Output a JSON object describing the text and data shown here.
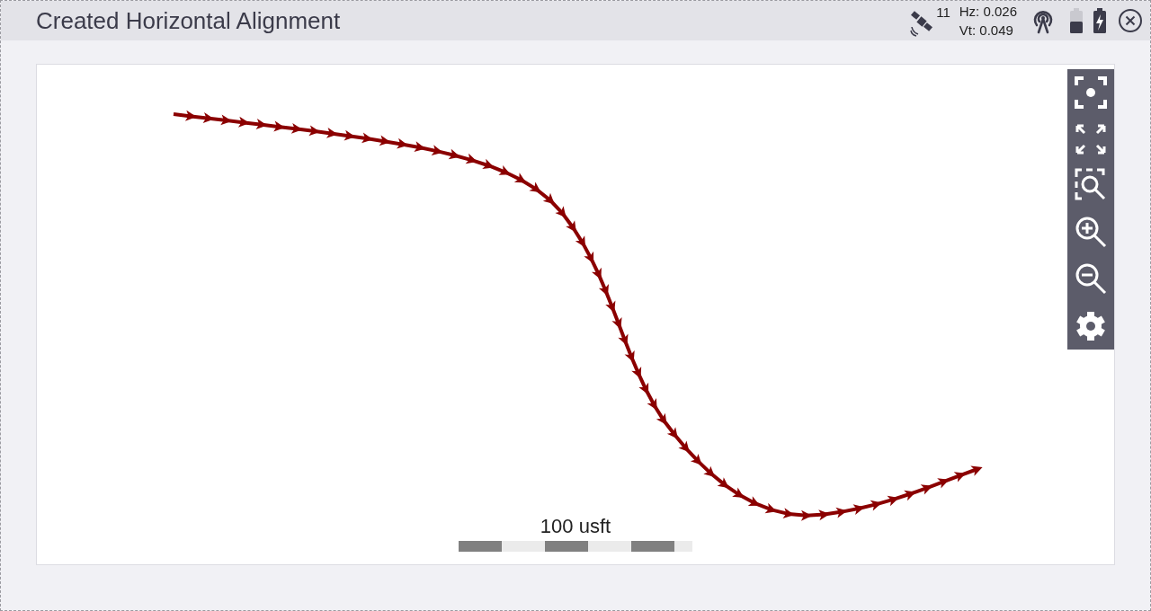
{
  "window": {
    "title": "Created Horizontal Alignment"
  },
  "status": {
    "satellites": "11",
    "hz": "Hz: 0.026",
    "vt": "Vt: 0.049"
  },
  "map": {
    "scale_label": "100 usft"
  }
}
